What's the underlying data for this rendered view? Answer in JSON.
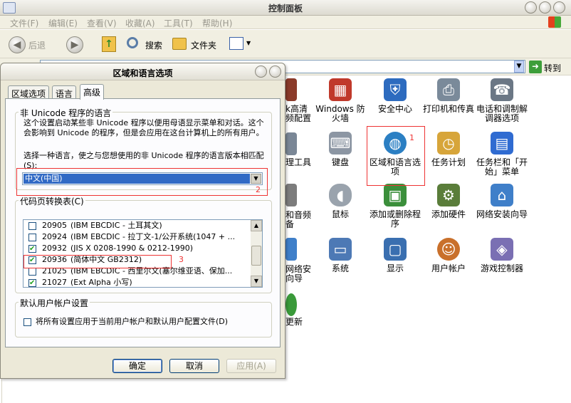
{
  "window": {
    "title": "控制面板"
  },
  "menu": [
    "文件(F)",
    "编辑(E)",
    "查看(V)",
    "收藏(A)",
    "工具(T)",
    "帮助(H)"
  ],
  "toolbar": {
    "back": "后退",
    "search": "搜索",
    "folders": "文件夹"
  },
  "address": {
    "go": "转到"
  },
  "cp_items": [
    {
      "label": "Windows 防火墙",
      "icon": "firewall-icon",
      "color": "#c0392b"
    },
    {
      "label": "安全中心",
      "icon": "security-center-icon",
      "color": "#2d6bbf"
    },
    {
      "label": "打印机和传真",
      "icon": "printer-icon",
      "color": "#7a8a9a"
    },
    {
      "label": "电话和调制解调器选项",
      "icon": "phone-modem-icon",
      "color": "#6b7785"
    },
    {
      "label": "键盘",
      "icon": "keyboard-icon",
      "color": "#8c96a3"
    },
    {
      "label": "区域和语言选项",
      "icon": "globe-icon",
      "color": "#2b7fc3"
    },
    {
      "label": "任务计划",
      "icon": "scheduled-tasks-icon",
      "color": "#d7a53a"
    },
    {
      "label": "任务栏和「开始」菜单",
      "icon": "taskbar-icon",
      "color": "#2f6bd1"
    },
    {
      "label": "鼠标",
      "icon": "mouse-icon",
      "color": "#9aa3ad"
    },
    {
      "label": "添加或删除程序",
      "icon": "add-remove-icon",
      "color": "#3b8f3b"
    },
    {
      "label": "添加硬件",
      "icon": "add-hardware-icon",
      "color": "#5a7d3a"
    },
    {
      "label": "网络安装向导",
      "icon": "network-wizard-icon",
      "color": "#3f7fc9"
    },
    {
      "label": "系统",
      "icon": "system-icon",
      "color": "#4d79b5"
    },
    {
      "label": "显示",
      "icon": "display-icon",
      "color": "#3a6fb0"
    },
    {
      "label": "用户帐户",
      "icon": "user-accounts-icon",
      "color": "#c9702b"
    },
    {
      "label": "游戏控制器",
      "icon": "game-controller-icon",
      "color": "#7a6fb3"
    }
  ],
  "cp_partial": [
    "k高清",
    "频配置",
    "理工具",
    "和音频",
    "备",
    "网络安",
    "向导",
    "更新"
  ],
  "dialog": {
    "title": "区域和语言选项",
    "tabs": [
      "区域选项",
      "语言",
      "高级"
    ],
    "unicode_group": "非 Unicode 程序的语言",
    "unicode_desc": "这个设置启动某些非 Unicode 程序以便用母语显示菜单和对话。这个会影响到 Unicode 的程序，但是会应用在这台计算机上的所有用户。",
    "select_prompt": "选择一种语言，使之与您想使用的非 Unicode 程序的语言版本相匹配(S):",
    "selected_language": "中文(中国)",
    "codepage_group": "代码页转换表(C)",
    "codepages": [
      {
        "code": "20905",
        "desc": "(IBM EBCDIC - 土耳其文)",
        "checked": false
      },
      {
        "code": "20924",
        "desc": "(IBM EBCDIC - 拉丁文-1/公开系统(1047 + ...",
        "checked": false
      },
      {
        "code": "20932",
        "desc": "(JIS X 0208-1990 & 0212-1990)",
        "checked": true
      },
      {
        "code": "20936",
        "desc": "(简体中文 GB2312)",
        "checked": true
      },
      {
        "code": "21025",
        "desc": "(IBM EBCDIC - 西里尔文(塞尔维亚语、保加...",
        "checked": false
      },
      {
        "code": "21027",
        "desc": "(Ext Alpha 小写)",
        "checked": true
      }
    ],
    "default_user_group": "默认用户帐户设置",
    "default_user_option": "将所有设置应用于当前用户帐户和默认用户配置文件(D)",
    "buttons": {
      "ok": "确定",
      "cancel": "取消",
      "apply": "应用(A)"
    }
  },
  "annotations": [
    "1",
    "2",
    "3"
  ]
}
